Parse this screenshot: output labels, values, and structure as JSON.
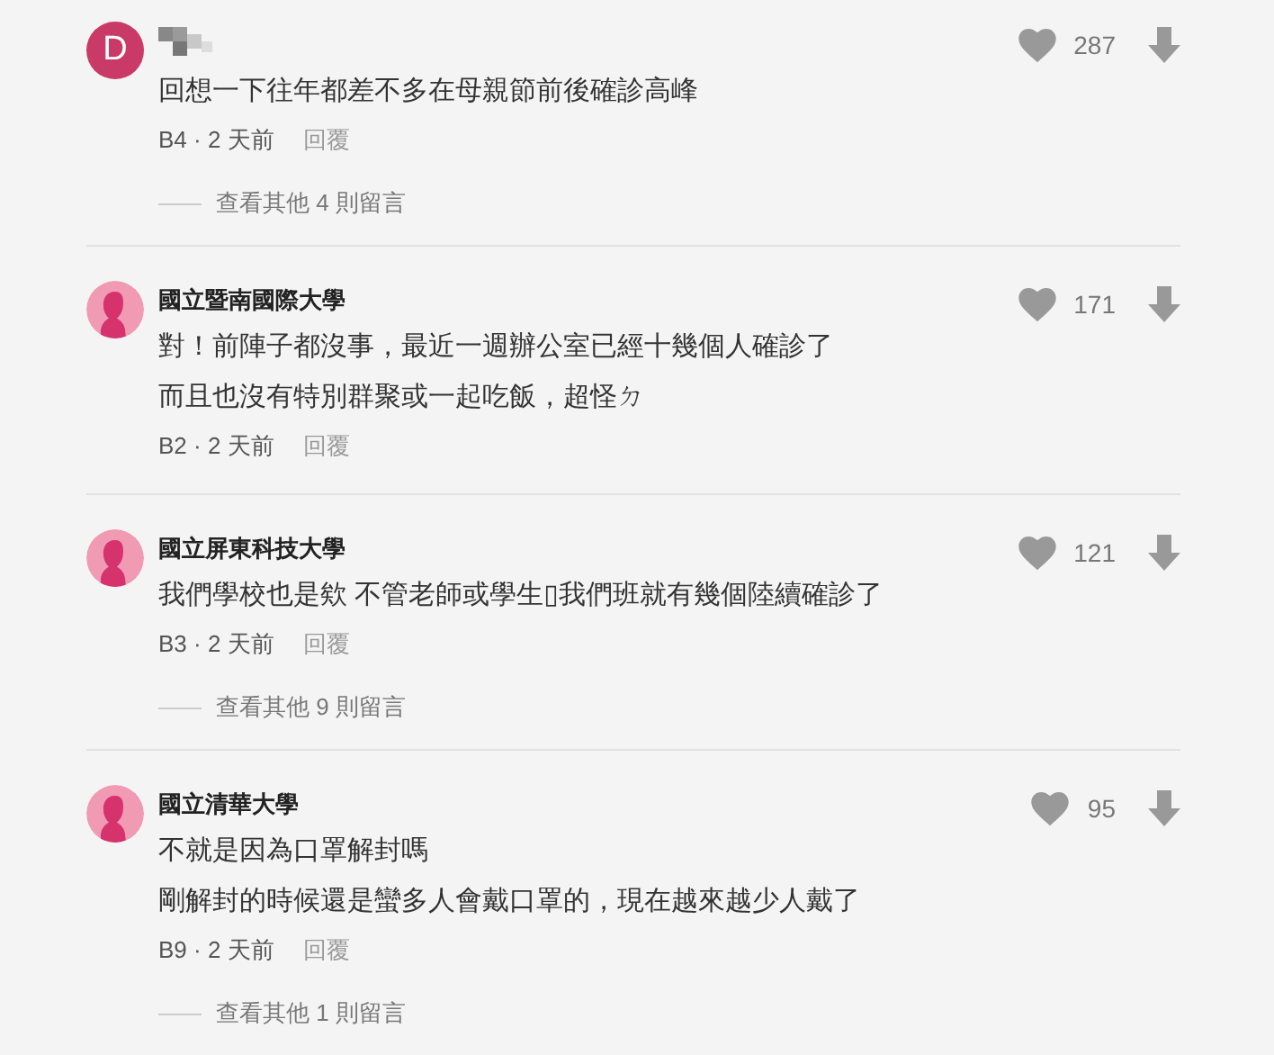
{
  "comments": [
    {
      "avatar": {
        "kind": "letter",
        "letter": "D",
        "color": "#c93a69"
      },
      "lines": [
        "回想一下往年都差不多在母親節前後確診高峰"
      ],
      "floor": "B4 · 2 天前",
      "reply": "回覆",
      "likes": "287",
      "more": "查看其他 4 則留言"
    },
    {
      "avatar": {
        "kind": "silhouette"
      },
      "name": "國立暨南國際大學",
      "lines": [
        "對！前陣子都沒事，最近一週辦公室已經十幾個人確診了",
        "而且也沒有特別群聚或一起吃飯，超怪ㄉ"
      ],
      "floor": "B2 · 2 天前",
      "reply": "回覆",
      "likes": "171"
    },
    {
      "avatar": {
        "kind": "silhouette"
      },
      "name": "國立屏東科技大學",
      "lines": [
        "我們學校也是欸 不管老師或學生▯我們班就有幾個陸續確診了"
      ],
      "floor": "B3 · 2 天前",
      "reply": "回覆",
      "likes": "121",
      "more": "查看其他 9 則留言"
    },
    {
      "avatar": {
        "kind": "silhouette"
      },
      "name": "國立清華大學",
      "lines": [
        "不就是因為口罩解封嗎",
        "剛解封的時候還是蠻多人會戴口罩的，現在越來越少人戴了"
      ],
      "floor": "B9 · 2 天前",
      "reply": "回覆",
      "likes": "95",
      "more": "查看其他 1 則留言"
    }
  ]
}
